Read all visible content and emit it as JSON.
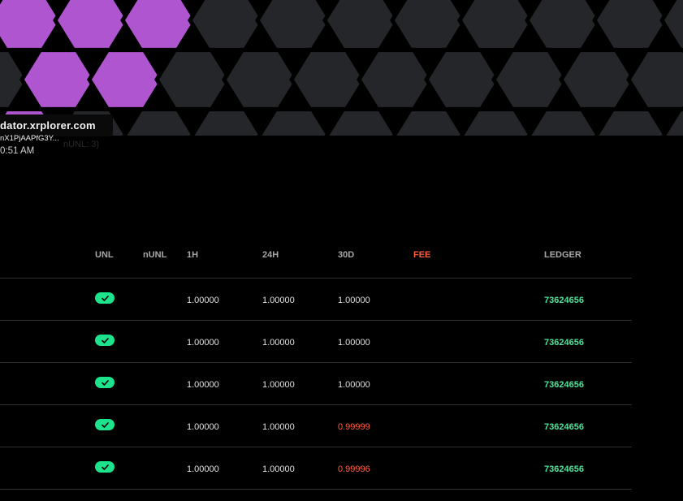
{
  "colors": {
    "hex_active": "#b055d0",
    "hex_inactive": "#252629",
    "hex_border": "#000000",
    "unl_badge": "#1de38c",
    "fee_header": "#ff5f3f",
    "ledger_text": "#4fe39a",
    "low_value": "#ff5f3f"
  },
  "tooltip": {
    "domain": "dator.xrplorer.com",
    "key": "nX1PjAAPfG3Y...",
    "ghost": "nUNL: 3)",
    "time": "0:51 AM"
  },
  "table": {
    "headers": {
      "unl": "UNL",
      "nunl": "nUNL",
      "h1": "1H",
      "h24": "24H",
      "d30": "30D",
      "fee": "FEE",
      "ledger": "LEDGER"
    },
    "rows": [
      {
        "unl": true,
        "h1": "1.00000",
        "h24": "1.00000",
        "d30": "1.00000",
        "d30_low": false,
        "ledger": "73624656"
      },
      {
        "unl": true,
        "h1": "1.00000",
        "h24": "1.00000",
        "d30": "1.00000",
        "d30_low": false,
        "ledger": "73624656"
      },
      {
        "unl": true,
        "h1": "1.00000",
        "h24": "1.00000",
        "d30": "1.00000",
        "d30_low": false,
        "ledger": "73624656"
      },
      {
        "unl": true,
        "h1": "1.00000",
        "h24": "1.00000",
        "d30": "0.99999",
        "d30_low": true,
        "ledger": "73624656"
      },
      {
        "unl": true,
        "h1": "1.00000",
        "h24": "1.00000",
        "d30": "0.99996",
        "d30_low": true,
        "ledger": "73624656"
      }
    ]
  }
}
